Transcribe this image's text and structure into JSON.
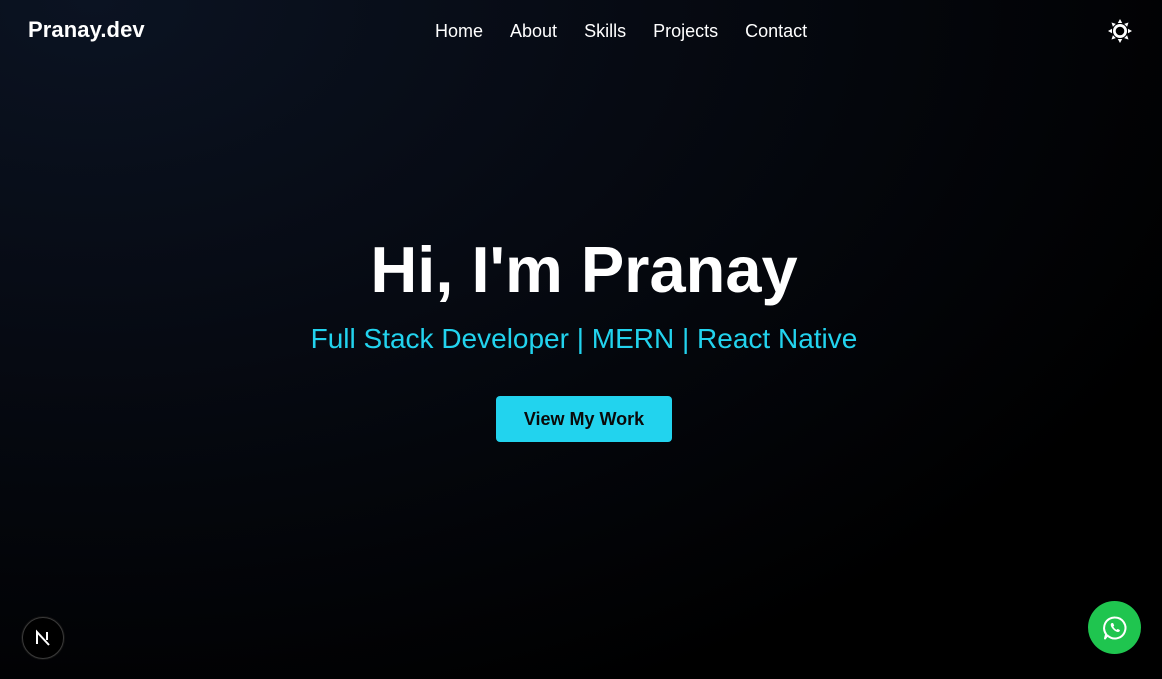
{
  "header": {
    "logo": "Pranay.dev",
    "nav": [
      {
        "label": "Home"
      },
      {
        "label": "About"
      },
      {
        "label": "Skills"
      },
      {
        "label": "Projects"
      },
      {
        "label": "Contact"
      }
    ],
    "theme_toggle_icon": "sun-icon"
  },
  "hero": {
    "title": "Hi, I'm Pranay",
    "subtitle": "Full Stack Developer | MERN | React Native",
    "cta_label": "View My Work"
  },
  "floating": {
    "dev_badge_icon": "nextjs-icon",
    "whatsapp_icon": "whatsapp-icon"
  },
  "colors": {
    "accent": "#22d3ee",
    "whatsapp": "#1fc54f",
    "background": "#000000"
  }
}
